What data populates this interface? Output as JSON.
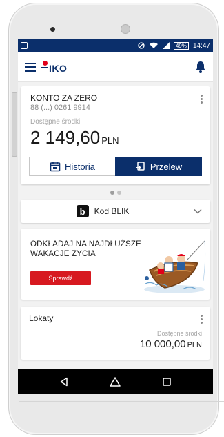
{
  "statusbar": {
    "battery": "49%",
    "time": "14:47"
  },
  "app": {
    "logo_text": "IKO"
  },
  "account": {
    "name": "KONTO ZA ZERO",
    "number": "88 (...) 0261 9914",
    "available_label": "Dostępne środki",
    "balance": "2 149,60",
    "currency": "PLN",
    "history_label": "Historia",
    "transfer_label": "Przelew"
  },
  "pager": {
    "pages": 2,
    "active": 1
  },
  "blik": {
    "label": "Kod BLIK",
    "logo_letter": "b"
  },
  "promo": {
    "line1": "ODKŁADAJ NA NAJDŁUŻSZE",
    "line2": "WAKACJE ŻYCIA",
    "button_label": "Sprawdź"
  },
  "deposit": {
    "title": "Lokaty",
    "available_label": "Dostępne środki",
    "amount": "10 000,00",
    "currency": "PLN"
  },
  "colors": {
    "primary": "#0b2f6b",
    "accent_red": "#d71920",
    "logo_red": "#e2001a"
  }
}
